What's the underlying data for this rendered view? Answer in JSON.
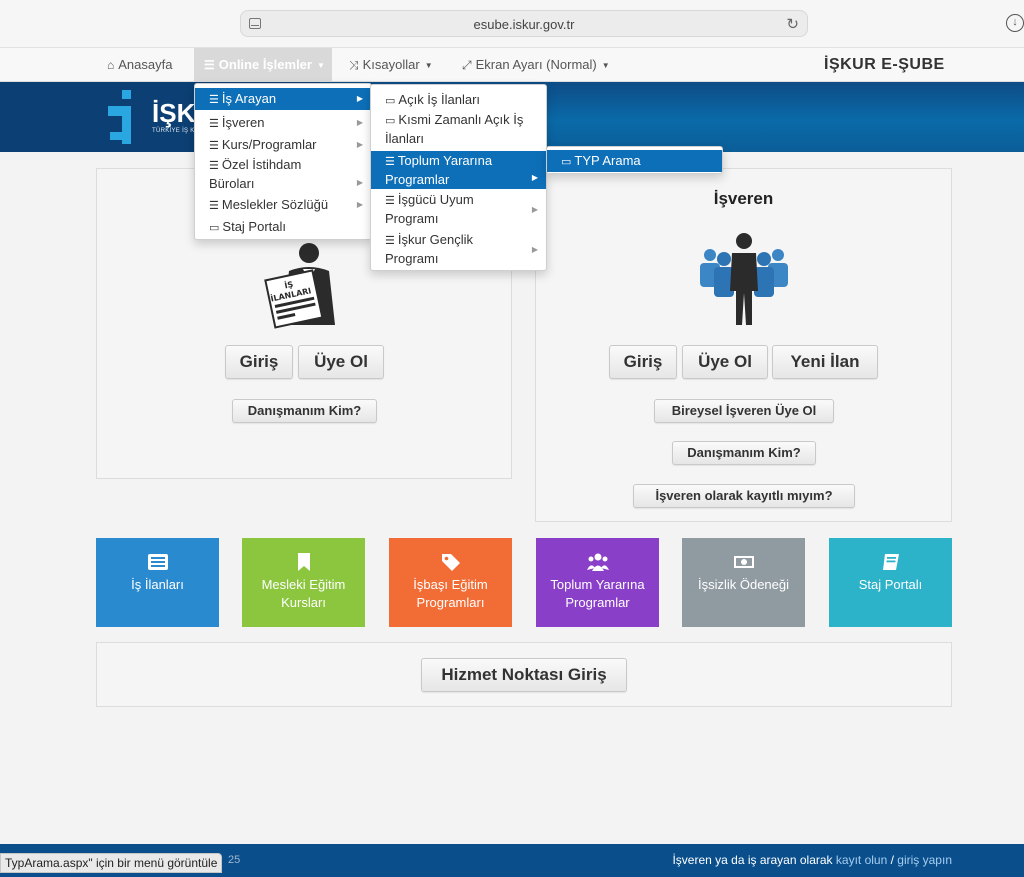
{
  "browser": {
    "url": "esube.iskur.gov.tr"
  },
  "nav": {
    "home": "Anasayfa",
    "online": "Online İşlemler",
    "shortcuts": "Kısayollar",
    "screen": "Ekran Ayarı (Normal)",
    "brand": "İŞKUR E-ŞUBE"
  },
  "logo": {
    "text": "İŞKU",
    "sub": "TÜRKİYE İŞ K"
  },
  "menu1": [
    "İş Arayan",
    "İşveren",
    "Kurs/Programlar",
    "Özel İstihdam",
    "Büroları",
    "Meslekler Sözlüğü",
    "Staj Portalı"
  ],
  "menu2": [
    "Açık İş İlanları",
    "Kısmi Zamanlı Açık İş",
    "İlanları",
    "Toplum Yararına",
    "Programlar",
    "İşgücü Uyum",
    "Programı",
    "İşkur Gençlik",
    "Programı"
  ],
  "menu3": [
    "TYP Arama"
  ],
  "jobseeker": {
    "badge_line1": "İŞ",
    "badge_line2": "İLANLARI",
    "login": "Giriş",
    "register": "Üye Ol",
    "advisor": "Danışmanım Kim?"
  },
  "employer": {
    "title": "İşveren",
    "login": "Giriş",
    "register": "Üye Ol",
    "new_ad": "Yeni İlan",
    "individual": "Bireysel İşveren Üye Ol",
    "advisor": "Danışmanım Kim?",
    "registered": "İşveren olarak kayıtlı mıyım?"
  },
  "tiles": [
    {
      "l1": "İş İlanları",
      "l2": "",
      "color": "#2a8ad0"
    },
    {
      "l1": "Mesleki Eğitim",
      "l2": "Kursları",
      "color": "#8cc63f"
    },
    {
      "l1": "İşbaşı Eğitim",
      "l2": "Programları",
      "color": "#f26c36"
    },
    {
      "l1": "Toplum Yararına",
      "l2": "Programlar",
      "color": "#8a3fc9"
    },
    {
      "l1": "İşsizlik Ödeneği",
      "l2": "",
      "color": "#8f9aa1"
    },
    {
      "l1": "Staj Portalı",
      "l2": "",
      "color": "#2cb2c9"
    }
  ],
  "service": {
    "label": "Hizmet Noktası Giriş"
  },
  "footer": {
    "year": "25",
    "prefix": "İşveren ya da iş arayan olarak",
    "register": "kayıt olun",
    "sep": "/",
    "login": "giriş yapın"
  },
  "status": "TypArama.aspx\" için bir menü görüntüle"
}
